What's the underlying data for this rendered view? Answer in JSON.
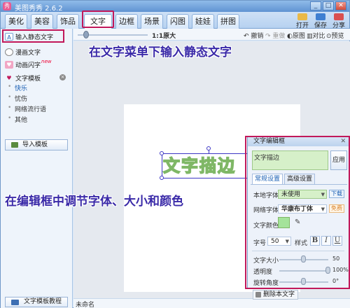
{
  "app": {
    "title": "美图秀秀 2.6.2",
    "logo_text": "秀"
  },
  "window_buttons": [
    "_",
    "□",
    "✕"
  ],
  "tabs": [
    {
      "label": "美化",
      "active": false
    },
    {
      "label": "美容",
      "active": false
    },
    {
      "label": "饰品",
      "active": false
    },
    {
      "label": "文字",
      "active": true
    },
    {
      "label": "边框",
      "active": false
    },
    {
      "label": "场景",
      "active": false
    },
    {
      "label": "闪图",
      "active": false
    },
    {
      "label": "娃娃",
      "active": false
    },
    {
      "label": "拼图",
      "active": false
    }
  ],
  "top_actions": [
    {
      "label": "打开"
    },
    {
      "label": "保存"
    },
    {
      "label": "分享"
    }
  ],
  "sidebar": {
    "items": [
      {
        "label": "输入静态文字",
        "icon": "text-a-icon"
      },
      {
        "label": "漫画文字",
        "icon": "comic-bubble-icon"
      },
      {
        "label": "动画闪字",
        "icon": "animated-text-icon",
        "badge": "new"
      },
      {
        "label": "文字模板",
        "icon": "template-icon"
      }
    ],
    "template_sub": [
      {
        "label": "快乐",
        "selected": true
      },
      {
        "label": "忧伤",
        "selected": false
      },
      {
        "label": "网络流行语",
        "selected": false
      },
      {
        "label": "其他",
        "selected": false
      }
    ],
    "import_label": "导入模板",
    "tutorial_label": "文字模板教程"
  },
  "toolbar": {
    "zoom_label": "1:1原大",
    "undo": "撤销",
    "redo": "重做",
    "original": "原图",
    "compare": "对比",
    "preview": "预览"
  },
  "canvas": {
    "text": "文字描边"
  },
  "statusbar": {
    "filename": "未命名"
  },
  "panel": {
    "title": "文字编辑框",
    "text_value": "文字描边",
    "apply": "应用",
    "tab_common": "常规设置",
    "tab_advanced": "高级设置",
    "local_font_label": "本地字体",
    "local_font_value": "未使用",
    "download": "下载",
    "web_font_label": "网络字体",
    "web_font_value": "华康布丁体",
    "free": "免费",
    "color_label": "文字颜色",
    "text_color": "#a4e39a",
    "size_label": "字号",
    "size_value": "50",
    "style_label": "样式",
    "bold": "B",
    "italic": "I",
    "underline": "U",
    "text_size_label": "文字大小",
    "text_size_value": "50",
    "text_size_pct": 0.5,
    "opacity_label": "透明度",
    "opacity_value": "100%",
    "opacity_pct": 1.0,
    "rotation_label": "旋转角度",
    "rotation_value": "0°",
    "rotation_pct": 0.5,
    "delete_label": "删除本文字"
  },
  "annotations": {
    "top": "在文字菜单下输入静态文字",
    "middle": "在编辑框中调节字体、大小和颜色"
  },
  "colors": {
    "highlight": "#c1185a",
    "annotation": "#3a2aa8",
    "stroke": "#7fb766",
    "fill": "#cbe9a8"
  }
}
